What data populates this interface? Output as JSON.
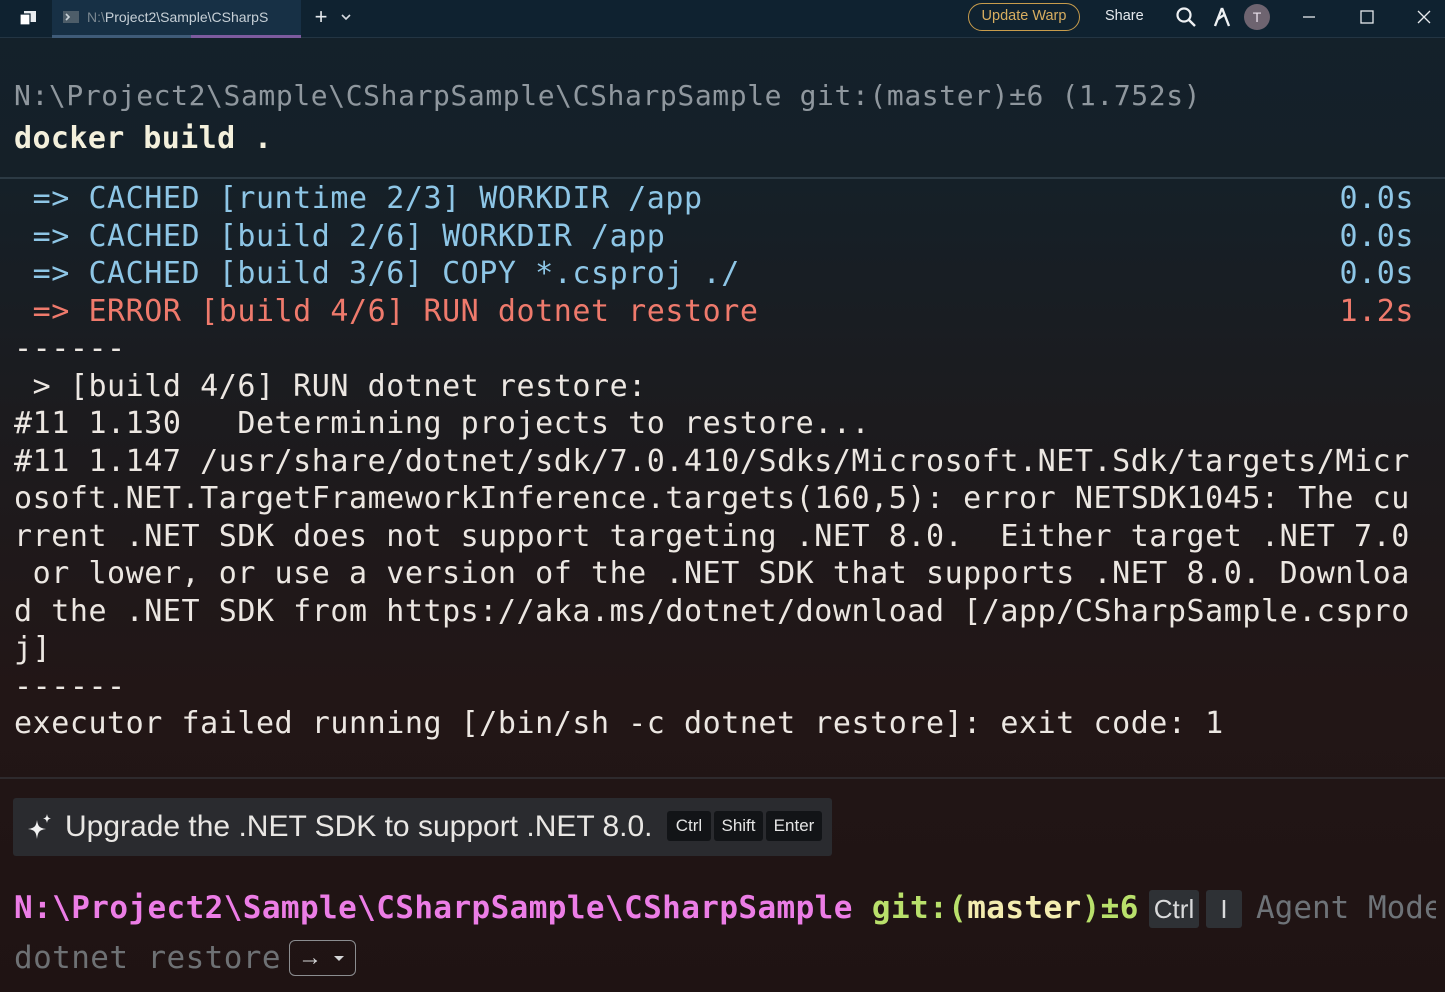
{
  "titlebar": {
    "tab": {
      "title_prefix": "N:\\",
      "title_rest": "Project2\\Sample\\CSharpS",
      "icon": "terminal-icon"
    },
    "new_tab_icon": "+",
    "update_label": "Update Warp",
    "share_label": "Share",
    "avatar_initial": "T",
    "accent_color": "#c79c4c"
  },
  "block": {
    "prompt": "N:\\Project2\\Sample\\CSharpSample\\CSharpSample git:(master)±6 (1.752s)",
    "command": "docker build .",
    "lines": [
      {
        "text": " => CACHED [runtime 2/3] WORKDIR /app",
        "time": "0.0s",
        "kind": "cached"
      },
      {
        "text": " => CACHED [build 2/6] WORKDIR /app",
        "time": "0.0s",
        "kind": "cached"
      },
      {
        "text": " => CACHED [build 3/6] COPY *.csproj ./",
        "time": "0.0s",
        "kind": "cached"
      },
      {
        "text": " => ERROR [build 4/6] RUN dotnet restore",
        "time": "1.2s",
        "kind": "error"
      },
      {
        "text": "------",
        "time": "",
        "kind": "plain"
      },
      {
        "text": " > [build 4/6] RUN dotnet restore:",
        "time": "",
        "kind": "plain"
      },
      {
        "text": "#11 1.130   Determining projects to restore...",
        "time": "",
        "kind": "plain"
      },
      {
        "text": "#11 1.147 /usr/share/dotnet/sdk/7.0.410/Sdks/Microsoft.NET.Sdk/targets/Micr",
        "time": "",
        "kind": "plain"
      },
      {
        "text": "osoft.NET.TargetFrameworkInference.targets(160,5): error NETSDK1045: The cu",
        "time": "",
        "kind": "plain"
      },
      {
        "text": "rrent .NET SDK does not support targeting .NET 8.0.  Either target .NET 7.0",
        "time": "",
        "kind": "plain"
      },
      {
        "text": " or lower, or use a version of the .NET SDK that supports .NET 8.0. Downloa",
        "time": "",
        "kind": "plain"
      },
      {
        "text": "d the .NET SDK from https://aka.ms/dotnet/download [/app/CSharpSample.cspro",
        "time": "",
        "kind": "plain"
      },
      {
        "text": "j]",
        "time": "",
        "kind": "plain"
      },
      {
        "text": "------",
        "time": "",
        "kind": "plain"
      },
      {
        "text": "executor failed running [/bin/sh -c dotnet restore]: exit code: 1",
        "time": "",
        "kind": "plain"
      }
    ]
  },
  "suggestion": {
    "text": "Upgrade the .NET SDK to support .NET 8.0.",
    "keys": [
      "Ctrl",
      "Shift",
      "Enter"
    ],
    "icon": "sparkle-icon"
  },
  "input": {
    "path": "N:\\Project2\\Sample\\CSharpSample\\CSharpSample",
    "git_prefix": " git:(",
    "branch": "master",
    "git_suffix": ")±6",
    "kbd_ctrl": "Ctrl",
    "kbd_i": "I",
    "agent_mode": "Agent Mode",
    "ghost_command": "dotnet restore",
    "accept_arrow": "→"
  },
  "colors": {
    "cached": "#8ec6e6",
    "error": "#ef7a6c",
    "prompt_path": "#ec7de6",
    "prompt_git": "#b9e06b"
  }
}
